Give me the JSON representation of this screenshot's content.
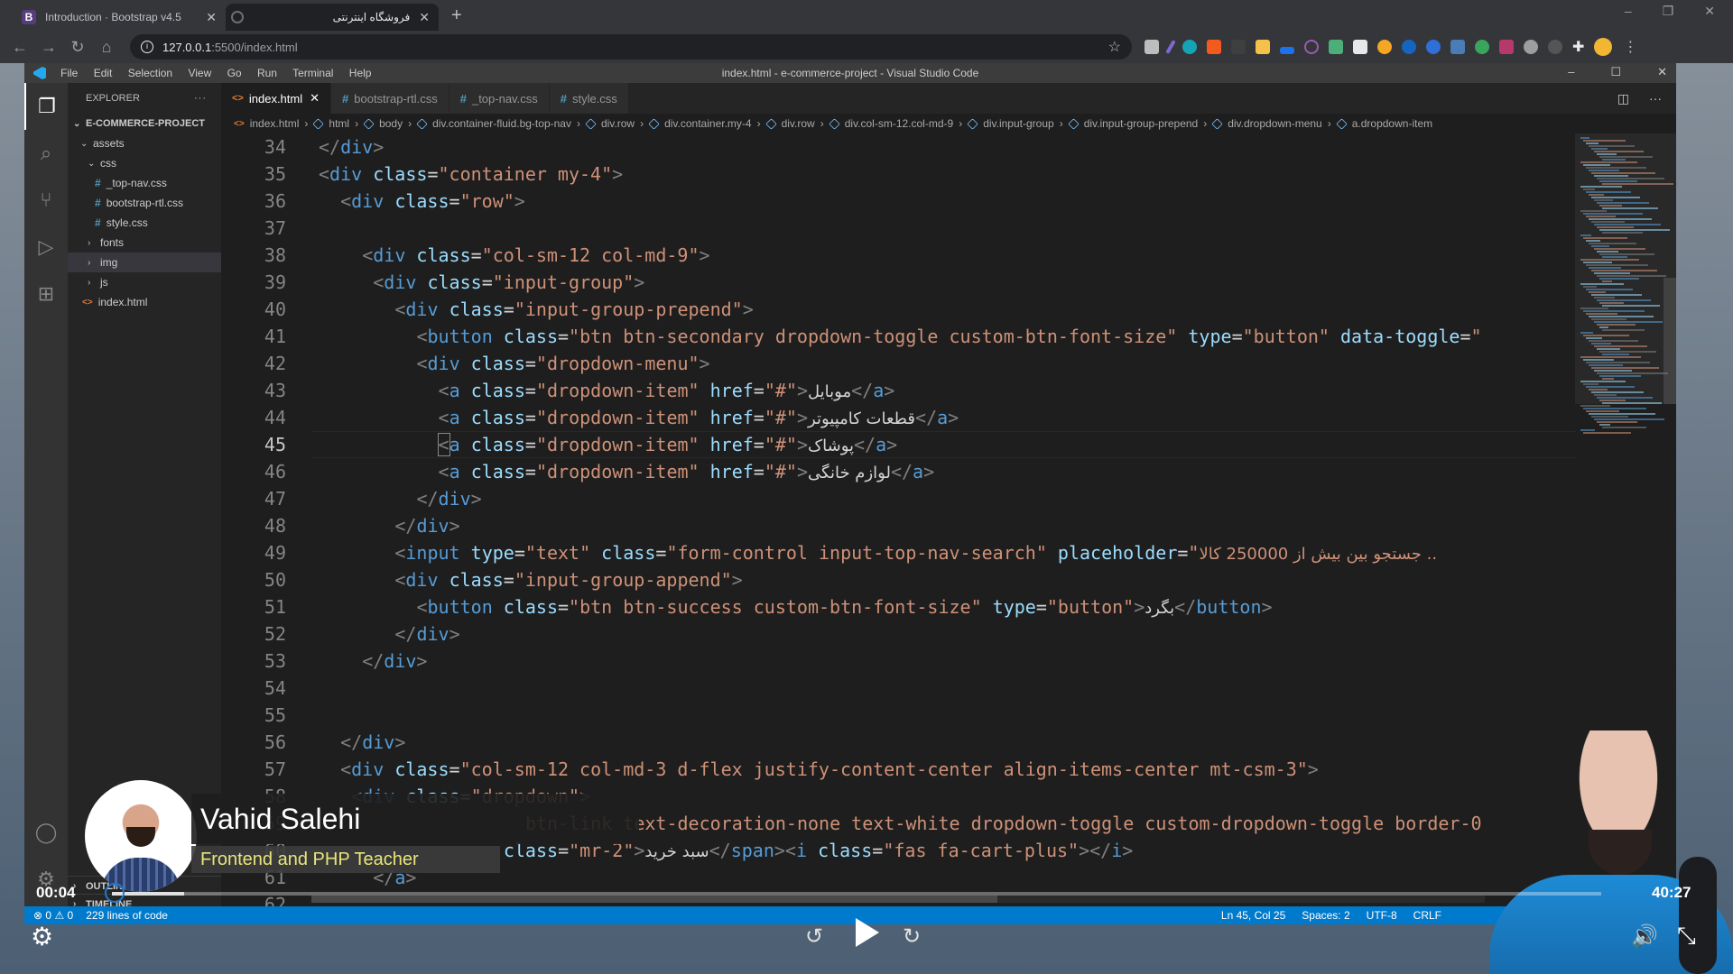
{
  "browser": {
    "tabs": [
      {
        "title": "Introduction · Bootstrap v4.5",
        "favicon": "bootstrap-icon",
        "favicon_letter": "B",
        "active": false
      },
      {
        "title": "فروشگاه اینترنتی",
        "favicon": "globe-icon",
        "active": true
      }
    ],
    "new_tab": "+",
    "window_controls": [
      "–",
      "❐",
      "✕"
    ],
    "url_host": "127.0.0.1",
    "url_path": ":5500/index.html",
    "extensions_count": 18
  },
  "vscode": {
    "window_title": "index.html - e-commerce-project - Visual Studio Code",
    "menu": [
      "File",
      "Edit",
      "Selection",
      "View",
      "Go",
      "Run",
      "Terminal",
      "Help"
    ],
    "window_controls": [
      "–",
      "☐",
      "✕"
    ],
    "explorer": {
      "header": "EXPLORER",
      "more": "···",
      "project": "E-COMMERCE-PROJECT",
      "tree": [
        {
          "label": "assets",
          "type": "folder",
          "open": true,
          "depth": 1
        },
        {
          "label": "css",
          "type": "folder",
          "open": true,
          "depth": 2
        },
        {
          "label": "_top-nav.css",
          "type": "css",
          "depth": 3
        },
        {
          "label": "bootstrap-rtl.css",
          "type": "css",
          "depth": 3
        },
        {
          "label": "style.css",
          "type": "css",
          "depth": 3
        },
        {
          "label": "fonts",
          "type": "folder",
          "open": false,
          "depth": 2
        },
        {
          "label": "img",
          "type": "folder",
          "open": false,
          "depth": 2,
          "selected": true
        },
        {
          "label": "js",
          "type": "folder",
          "open": false,
          "depth": 2
        },
        {
          "label": "index.html",
          "type": "html",
          "depth": 1
        }
      ],
      "outline": "OUTLINE",
      "timeline": "TIMELINE"
    },
    "tabs": [
      {
        "label": "index.html",
        "type": "html",
        "active": true
      },
      {
        "label": "bootstrap-rtl.css",
        "type": "css",
        "active": false
      },
      {
        "label": "_top-nav.css",
        "type": "css",
        "active": false
      },
      {
        "label": "style.css",
        "type": "css",
        "active": false
      }
    ],
    "breadcrumbs": [
      "index.html",
      "html",
      "body",
      "div.container-fluid.bg-top-nav",
      "div.row",
      "div.container.my-4",
      "div.row",
      "div.col-sm-12.col-md-9",
      "div.input-group",
      "div.input-group-prepend",
      "div.dropdown-menu",
      "a.dropdown-item"
    ],
    "code_lines": [
      {
        "n": "34",
        "indent": 0,
        "tokens": [
          [
            "br",
            "</"
          ],
          [
            "tag",
            "div"
          ],
          [
            "br",
            ">"
          ]
        ]
      },
      {
        "n": "35",
        "indent": 0,
        "tokens": [
          [
            "br",
            "<"
          ],
          [
            "tag",
            "div"
          ],
          [
            "txt",
            " "
          ],
          [
            "attr",
            "class"
          ],
          [
            "eq",
            "="
          ],
          [
            "str",
            "\"container my-4\""
          ],
          [
            "br",
            ">"
          ]
        ]
      },
      {
        "n": "36",
        "indent": 1,
        "tokens": [
          [
            "br",
            "<"
          ],
          [
            "tag",
            "div"
          ],
          [
            "txt",
            " "
          ],
          [
            "attr",
            "class"
          ],
          [
            "eq",
            "="
          ],
          [
            "str",
            "\"row\""
          ],
          [
            "br",
            ">"
          ]
        ]
      },
      {
        "n": "37",
        "indent": 0,
        "tokens": []
      },
      {
        "n": "38",
        "indent": 2,
        "tokens": [
          [
            "br",
            "<"
          ],
          [
            "tag",
            "div"
          ],
          [
            "txt",
            " "
          ],
          [
            "attr",
            "class"
          ],
          [
            "eq",
            "="
          ],
          [
            "str",
            "\"col-sm-12 col-md-9\""
          ],
          [
            "br",
            ">"
          ]
        ]
      },
      {
        "n": "39",
        "indent": 2.5,
        "tokens": [
          [
            "br",
            "<"
          ],
          [
            "tag",
            "div"
          ],
          [
            "txt",
            " "
          ],
          [
            "attr",
            "class"
          ],
          [
            "eq",
            "="
          ],
          [
            "str",
            "\"input-group\""
          ],
          [
            "br",
            ">"
          ]
        ]
      },
      {
        "n": "40",
        "indent": 3.5,
        "tokens": [
          [
            "br",
            "<"
          ],
          [
            "tag",
            "div"
          ],
          [
            "txt",
            " "
          ],
          [
            "attr",
            "class"
          ],
          [
            "eq",
            "="
          ],
          [
            "str",
            "\"input-group-prepend\""
          ],
          [
            "br",
            ">"
          ]
        ]
      },
      {
        "n": "41",
        "indent": 4.5,
        "tokens": [
          [
            "br",
            "<"
          ],
          [
            "tag",
            "button"
          ],
          [
            "txt",
            " "
          ],
          [
            "attr",
            "class"
          ],
          [
            "eq",
            "="
          ],
          [
            "str",
            "\"btn btn-secondary dropdown-toggle custom-btn-font-size\""
          ],
          [
            "txt",
            " "
          ],
          [
            "attr",
            "type"
          ],
          [
            "eq",
            "="
          ],
          [
            "str",
            "\"button\""
          ],
          [
            "txt",
            " "
          ],
          [
            "attr",
            "data-toggle"
          ],
          [
            "eq",
            "="
          ],
          [
            "str",
            "\""
          ]
        ]
      },
      {
        "n": "42",
        "indent": 4.5,
        "tokens": [
          [
            "br",
            "<"
          ],
          [
            "tag",
            "div"
          ],
          [
            "txt",
            " "
          ],
          [
            "attr",
            "class"
          ],
          [
            "eq",
            "="
          ],
          [
            "str",
            "\"dropdown-menu\""
          ],
          [
            "br",
            ">"
          ]
        ]
      },
      {
        "n": "43",
        "indent": 5.5,
        "tokens": [
          [
            "br",
            "<"
          ],
          [
            "tag",
            "a"
          ],
          [
            "txt",
            " "
          ],
          [
            "attr",
            "class"
          ],
          [
            "eq",
            "="
          ],
          [
            "str",
            "\"dropdown-item\""
          ],
          [
            "txt",
            " "
          ],
          [
            "attr",
            "href"
          ],
          [
            "eq",
            "="
          ],
          [
            "str",
            "\"#\""
          ],
          [
            "br",
            ">"
          ],
          [
            "rtl",
            "موبایل"
          ],
          [
            "br",
            "</"
          ],
          [
            "tag",
            "a"
          ],
          [
            "br",
            ">"
          ]
        ]
      },
      {
        "n": "44",
        "indent": 5.5,
        "tokens": [
          [
            "br",
            "<"
          ],
          [
            "tag",
            "a"
          ],
          [
            "txt",
            " "
          ],
          [
            "attr",
            "class"
          ],
          [
            "eq",
            "="
          ],
          [
            "str",
            "\"dropdown-item\""
          ],
          [
            "txt",
            " "
          ],
          [
            "attr",
            "href"
          ],
          [
            "eq",
            "="
          ],
          [
            "str",
            "\"#\""
          ],
          [
            "br",
            ">"
          ],
          [
            "rtl",
            "قطعات کامپیوتر"
          ],
          [
            "br",
            "</"
          ],
          [
            "tag",
            "a"
          ],
          [
            "br",
            ">"
          ]
        ]
      },
      {
        "n": "45",
        "indent": 5.5,
        "current": true,
        "tokens": [
          [
            "br",
            "<"
          ],
          [
            "tag",
            "a"
          ],
          [
            "txt",
            " "
          ],
          [
            "attr",
            "class"
          ],
          [
            "eq",
            "="
          ],
          [
            "str",
            "\"dropdown-item\""
          ],
          [
            "txt",
            " "
          ],
          [
            "attr",
            "href"
          ],
          [
            "eq",
            "="
          ],
          [
            "str",
            "\"#\""
          ],
          [
            "br",
            ">"
          ],
          [
            "rtl",
            "پوشاک"
          ],
          [
            "br",
            "</"
          ],
          [
            "tag",
            "a"
          ],
          [
            "br",
            ">"
          ]
        ]
      },
      {
        "n": "46",
        "indent": 5.5,
        "tokens": [
          [
            "br",
            "<"
          ],
          [
            "tag",
            "a"
          ],
          [
            "txt",
            " "
          ],
          [
            "attr",
            "class"
          ],
          [
            "eq",
            "="
          ],
          [
            "str",
            "\"dropdown-item\""
          ],
          [
            "txt",
            " "
          ],
          [
            "attr",
            "href"
          ],
          [
            "eq",
            "="
          ],
          [
            "str",
            "\"#\""
          ],
          [
            "br",
            ">"
          ],
          [
            "rtl",
            "لوازم خانگی"
          ],
          [
            "br",
            "</"
          ],
          [
            "tag",
            "a"
          ],
          [
            "br",
            ">"
          ]
        ]
      },
      {
        "n": "47",
        "indent": 4.5,
        "tokens": [
          [
            "br",
            "</"
          ],
          [
            "tag",
            "div"
          ],
          [
            "br",
            ">"
          ]
        ]
      },
      {
        "n": "48",
        "indent": 3.5,
        "tokens": [
          [
            "br",
            "</"
          ],
          [
            "tag",
            "div"
          ],
          [
            "br",
            ">"
          ]
        ]
      },
      {
        "n": "49",
        "indent": 3.5,
        "tokens": [
          [
            "br",
            "<"
          ],
          [
            "tag",
            "input"
          ],
          [
            "txt",
            " "
          ],
          [
            "attr",
            "type"
          ],
          [
            "eq",
            "="
          ],
          [
            "str",
            "\"text\""
          ],
          [
            "txt",
            " "
          ],
          [
            "attr",
            "class"
          ],
          [
            "eq",
            "="
          ],
          [
            "str",
            "\"form-control input-top-nav-search\""
          ],
          [
            "txt",
            " "
          ],
          [
            "attr",
            "placeholder"
          ],
          [
            "eq",
            "="
          ],
          [
            "str",
            "\""
          ],
          [
            "strrtl",
            "جستجو بین بیش از 250000 کالا .."
          ]
        ]
      },
      {
        "n": "50",
        "indent": 3.5,
        "tokens": [
          [
            "br",
            "<"
          ],
          [
            "tag",
            "div"
          ],
          [
            "txt",
            " "
          ],
          [
            "attr",
            "class"
          ],
          [
            "eq",
            "="
          ],
          [
            "str",
            "\"input-group-append\""
          ],
          [
            "br",
            ">"
          ]
        ]
      },
      {
        "n": "51",
        "indent": 4.5,
        "tokens": [
          [
            "br",
            "<"
          ],
          [
            "tag",
            "button"
          ],
          [
            "txt",
            " "
          ],
          [
            "attr",
            "class"
          ],
          [
            "eq",
            "="
          ],
          [
            "str",
            "\"btn btn-success custom-btn-font-size\""
          ],
          [
            "txt",
            " "
          ],
          [
            "attr",
            "type"
          ],
          [
            "eq",
            "="
          ],
          [
            "str",
            "\"button\""
          ],
          [
            "br",
            ">"
          ],
          [
            "rtl",
            "بگرد"
          ],
          [
            "br",
            "</"
          ],
          [
            "tag",
            "button"
          ],
          [
            "br",
            ">"
          ]
        ]
      },
      {
        "n": "52",
        "indent": 3.5,
        "tokens": [
          [
            "br",
            "</"
          ],
          [
            "tag",
            "div"
          ],
          [
            "br",
            ">"
          ]
        ]
      },
      {
        "n": "53",
        "indent": 2,
        "tokens": [
          [
            "br",
            "</"
          ],
          [
            "tag",
            "div"
          ],
          [
            "br",
            ">"
          ]
        ]
      },
      {
        "n": "54",
        "indent": 0,
        "tokens": []
      },
      {
        "n": "55",
        "indent": 0,
        "tokens": []
      },
      {
        "n": "56",
        "indent": 1,
        "tokens": [
          [
            "br",
            "</"
          ],
          [
            "tag",
            "div"
          ],
          [
            "br",
            ">"
          ]
        ]
      },
      {
        "n": "57",
        "indent": 1,
        "tokens": [
          [
            "br",
            "<"
          ],
          [
            "tag",
            "div"
          ],
          [
            "txt",
            " "
          ],
          [
            "attr",
            "class"
          ],
          [
            "eq",
            "="
          ],
          [
            "str",
            "\"col-sm-12 col-md-3 d-flex justify-content-center align-items-center mt-csm-3\""
          ],
          [
            "br",
            ">"
          ]
        ]
      },
      {
        "n": "58",
        "indent": 1.5,
        "tokens": [
          [
            "br",
            "<"
          ],
          [
            "tag",
            "div"
          ],
          [
            "txt",
            " "
          ],
          [
            "attr",
            "class"
          ],
          [
            "eq",
            "="
          ],
          [
            "str",
            "\"dropdown\""
          ],
          [
            "br",
            ">"
          ]
        ]
      },
      {
        "n": "59",
        "indent": 9.5,
        "tokens": [
          [
            "str",
            "btn-link text-decoration-none text-white dropdown-toggle custom-dropdown-toggle border-0"
          ]
        ]
      },
      {
        "n": "60",
        "indent": 8.5,
        "tokens": [
          [
            "attr",
            "class"
          ],
          [
            "eq",
            "="
          ],
          [
            "str",
            "\"mr-2\""
          ],
          [
            "br",
            ">"
          ],
          [
            "rtl",
            "سبد خرید"
          ],
          [
            "br",
            "</"
          ],
          [
            "tag",
            "span"
          ],
          [
            "br",
            "><"
          ],
          [
            "tag",
            "i"
          ],
          [
            "txt",
            " "
          ],
          [
            "attr",
            "class"
          ],
          [
            "eq",
            "="
          ],
          [
            "str",
            "\"fas fa-cart-plus\""
          ],
          [
            "br",
            "></"
          ],
          [
            "tag",
            "i"
          ],
          [
            "br",
            ">"
          ]
        ]
      },
      {
        "n": "61",
        "indent": 2.5,
        "tokens": [
          [
            "br",
            "</"
          ],
          [
            "tag",
            "a"
          ],
          [
            "br",
            ">"
          ]
        ]
      },
      {
        "n": "62",
        "indent": 0,
        "tokens": []
      }
    ],
    "status": {
      "errors": "0",
      "warnings": "0",
      "lines_of_code": "229 lines of code",
      "cursor": "Ln 45, Col 25",
      "spaces": "Spaces: 2",
      "encoding": "UTF-8",
      "eol": "CRLF"
    }
  },
  "video": {
    "presenter_name": "Vahid Salehi",
    "presenter_title": "Frontend and PHP Teacher",
    "current_time": "00:04",
    "total_time": "40:27",
    "progress_fraction": 0.002
  }
}
